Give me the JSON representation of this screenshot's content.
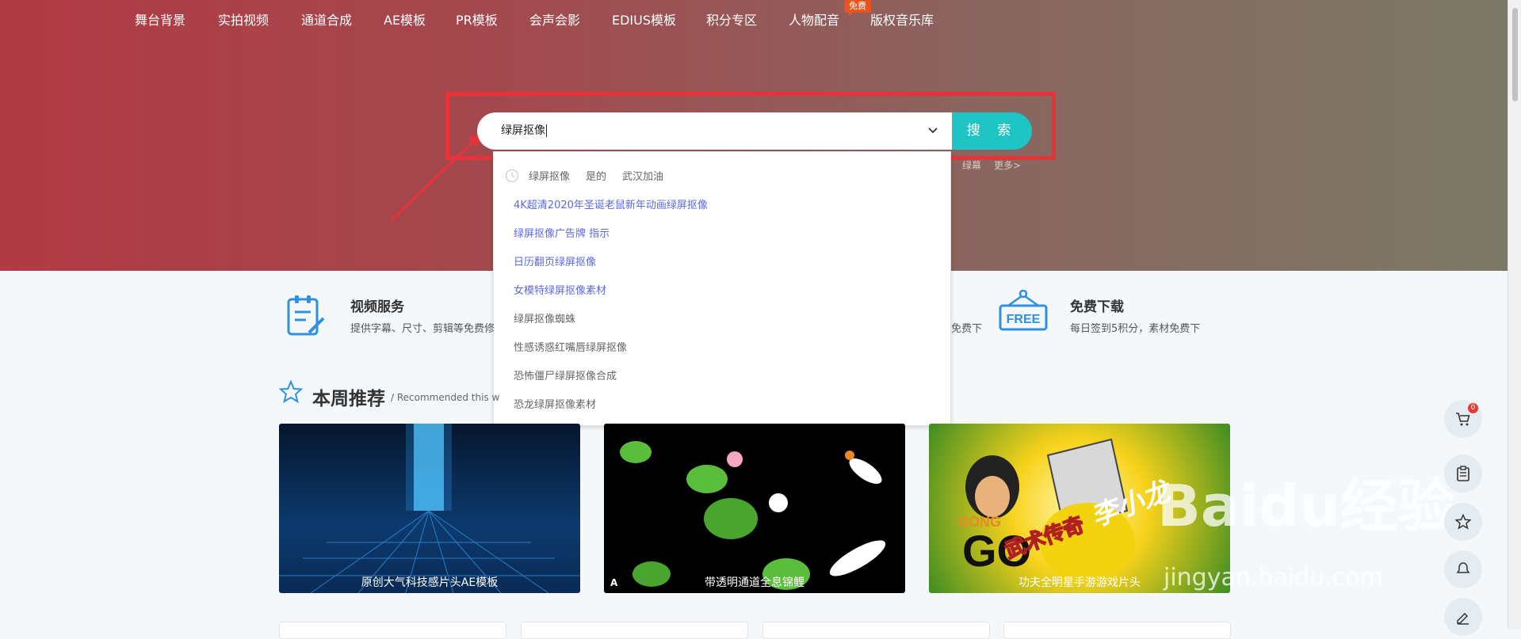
{
  "nav": {
    "items": [
      "舞台背景",
      "实拍视频",
      "通道合成",
      "AE模板",
      "PR模板",
      "会声会影",
      "EDIUS模板",
      "积分专区",
      "人物配音",
      "版权音乐库"
    ],
    "free_badge": "免费"
  },
  "search": {
    "value": "绿屏抠像",
    "button_label": "搜 索",
    "hot_tags_right": [
      "绿幕",
      "更多>"
    ]
  },
  "dropdown": {
    "history": [
      "绿屏抠像",
      "是的",
      "武汉加油"
    ],
    "suggestions": [
      {
        "text": "4K超清2020年圣诞老鼠新年动画绿屏抠像",
        "style": "blue"
      },
      {
        "text": "绿屏抠像广告牌 指示",
        "style": "blue"
      },
      {
        "text": "日历翻页绿屏抠像",
        "style": "blue"
      },
      {
        "text": "女模特绿屏抠像素材",
        "style": "blue"
      },
      {
        "text": "绿屏抠像蜘蛛",
        "style": "gray"
      },
      {
        "text": "性感诱惑红嘴唇绿屏抠像",
        "style": "gray"
      },
      {
        "text": "恐怖僵尸绿屏抠像合成",
        "style": "gray"
      },
      {
        "text": "恐龙绿屏抠像素材",
        "style": "gray"
      }
    ]
  },
  "services": [
    {
      "title": "视频服务",
      "desc": "提供字幕、尺寸、剪辑等免费修",
      "icon": "clipboard-edit-icon"
    },
    {
      "title": "",
      "desc": "免费下",
      "icon": ""
    },
    {
      "title": "免费下载",
      "desc": "每日签到5积分，素材免费下",
      "icon": "free-sign-icon"
    }
  ],
  "weekly": {
    "title": "本周推荐",
    "subtitle": "/ Recommended this w"
  },
  "cards": [
    {
      "caption": "原创大气科技感片头AE模板"
    },
    {
      "caption": "带透明通道全息锦鲤",
      "corner": "A"
    },
    {
      "caption": "功夫全明星手游游戏片头",
      "overlay_text": "武术传奇",
      "overlay_text2": "李小龙",
      "overlay_text3": "GONG"
    }
  ],
  "sidebar": {
    "cart_count": "0",
    "buttons": [
      "cart-icon",
      "clipboard-icon",
      "star-icon",
      "chat-icon",
      "edit-icon"
    ]
  },
  "watermark": {
    "main": "Baidu经验",
    "sub": "jingyan.baidu.com"
  },
  "colors": {
    "accent": "#1fc4c4",
    "highlight": "#e8323a",
    "link": "#5b6ae0"
  }
}
